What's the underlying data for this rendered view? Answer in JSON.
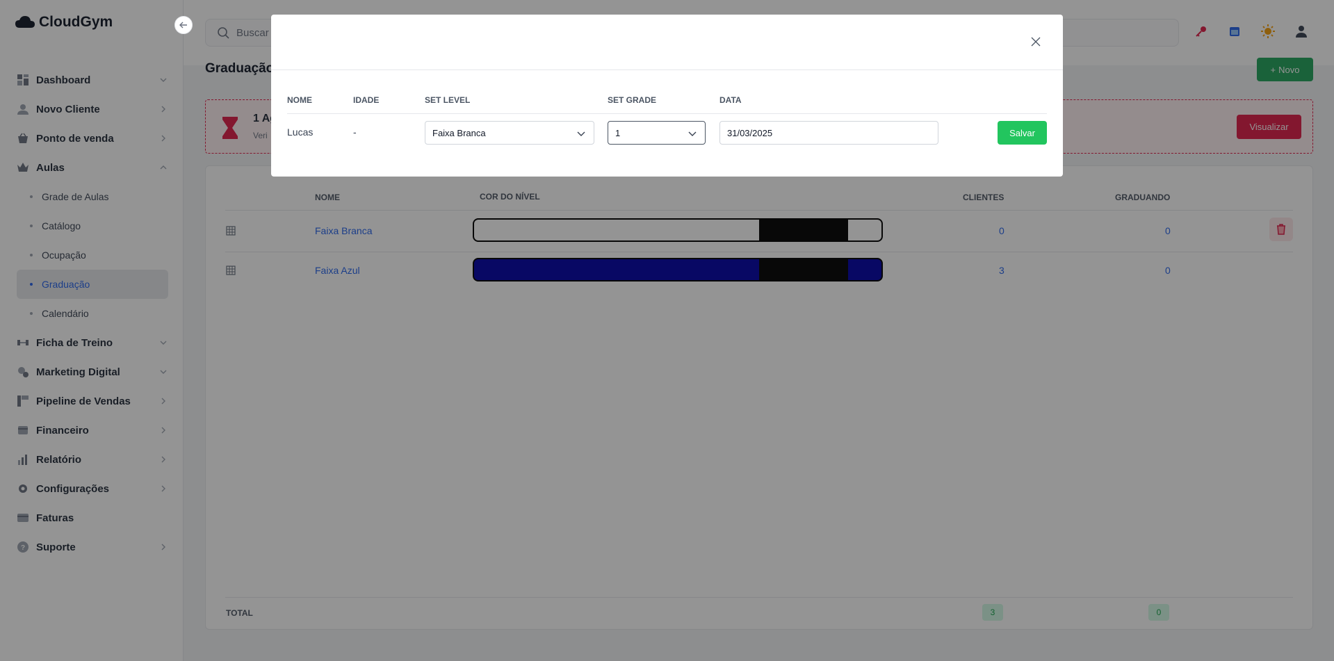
{
  "brand": {
    "name": "CloudGym",
    "accent": "#2563eb",
    "success": "#22a55b",
    "danger": "#e11d48"
  },
  "sidebar": {
    "items": [
      {
        "label": "Dashboard",
        "icon": "dashboard-icon",
        "chevron": "down"
      },
      {
        "label": "Novo Cliente",
        "icon": "user-icon",
        "chevron": "right"
      },
      {
        "label": "Ponto de venda",
        "icon": "basket-icon",
        "chevron": "right"
      },
      {
        "label": "Aulas",
        "icon": "crown-icon",
        "chevron": "up",
        "children": [
          {
            "label": "Grade de Aulas"
          },
          {
            "label": "Catálogo"
          },
          {
            "label": "Ocupação"
          },
          {
            "label": "Graduação",
            "active": true
          },
          {
            "label": "Calendário"
          }
        ]
      },
      {
        "label": "Ficha de Treino",
        "icon": "dumbbell-icon",
        "chevron": "down"
      },
      {
        "label": "Marketing Digital",
        "icon": "marketing-icon",
        "chevron": "down"
      },
      {
        "label": "Pipeline de Vendas",
        "icon": "pipeline-icon",
        "chevron": "right"
      },
      {
        "label": "Financeiro",
        "icon": "wallet-icon",
        "chevron": "right"
      },
      {
        "label": "Relatório",
        "icon": "chart-icon",
        "chevron": "right"
      },
      {
        "label": "Configurações",
        "icon": "gear-icon",
        "chevron": "right"
      },
      {
        "label": "Faturas",
        "icon": "card-icon",
        "chevron": ""
      },
      {
        "label": "Suporte",
        "icon": "help-icon",
        "chevron": "right"
      }
    ]
  },
  "search": {
    "placeholder": "Buscar"
  },
  "page": {
    "title": "Graduação",
    "new_label": "Novo"
  },
  "alert": {
    "title": "1 Ag",
    "subtitle": "Veri",
    "button": "Visualizar"
  },
  "table": {
    "headers": {
      "name": "NOME",
      "color": "COR DO NÍVEL",
      "clients": "CLIENTES",
      "graduating": "GRADUANDO"
    },
    "rows": [
      {
        "name": "Faixa Branca",
        "belt_color": "#ffffff",
        "clients": "0",
        "graduating": "0"
      },
      {
        "name": "Faixa Azul",
        "belt_color": "#0000a8",
        "clients": "3",
        "graduating": "0"
      }
    ],
    "total": {
      "label": "TOTAL",
      "clients": "3",
      "graduating": "0"
    }
  },
  "modal": {
    "headers": {
      "name": "NOME",
      "age": "IDADE",
      "level": "SET LEVEL",
      "grade": "SET GRADE",
      "date": "DATA"
    },
    "row": {
      "name": "Lucas",
      "age": "-",
      "level": "Faixa Branca",
      "grade": "1",
      "date": "31/03/2025"
    },
    "save_label": "Salvar"
  }
}
